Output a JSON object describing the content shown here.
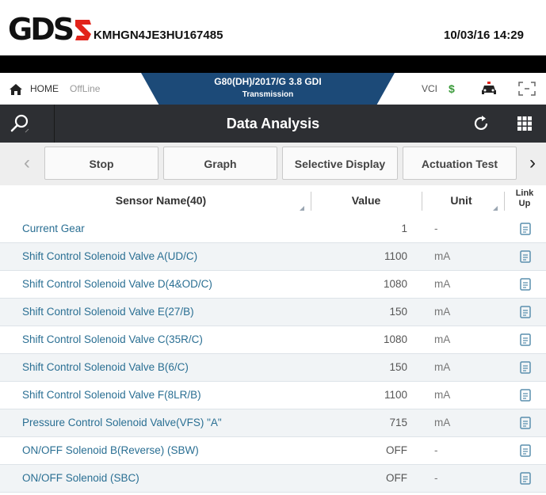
{
  "header": {
    "logo_text": "GDS",
    "vin": "KMHGN4JE3HU167485",
    "datetime": "10/03/16 14:29"
  },
  "nav": {
    "home_label": "HOME",
    "status": "OffLine",
    "vehicle": "G80(DH)/2017/G 3.8 GDI",
    "system": "Transmission",
    "vci_label": "VCI"
  },
  "page": {
    "title": "Data Analysis"
  },
  "toolbar": {
    "stop": "Stop",
    "graph": "Graph",
    "selective_display": "Selective Display",
    "actuation_test": "Actuation Test"
  },
  "table": {
    "columns": {
      "sensor": "Sensor Name(40)",
      "value": "Value",
      "unit": "Unit",
      "link_up_1": "Link",
      "link_up_2": "Up"
    },
    "rows": [
      {
        "name": "Current Gear",
        "value": "1",
        "unit": "-"
      },
      {
        "name": "Shift Control Solenoid Valve A(UD/C)",
        "value": "1100",
        "unit": "mA"
      },
      {
        "name": "Shift Control Solenoid Valve D(4&OD/C)",
        "value": "1080",
        "unit": "mA"
      },
      {
        "name": "Shift Control Solenoid Valve E(27/B)",
        "value": "150",
        "unit": "mA"
      },
      {
        "name": "Shift Control Solenoid Valve C(35R/C)",
        "value": "1080",
        "unit": "mA"
      },
      {
        "name": "Shift Control Solenoid Valve B(6/C)",
        "value": "150",
        "unit": "mA"
      },
      {
        "name": "Shift Control Solenoid Valve F(8LR/B)",
        "value": "1100",
        "unit": "mA"
      },
      {
        "name": "Pressure Control Solenoid Valve(VFS) \"A\"",
        "value": "715",
        "unit": "mA"
      },
      {
        "name": "ON/OFF Solenoid B(Reverse) (SBW)",
        "value": "OFF",
        "unit": "-"
      },
      {
        "name": "ON/OFF Solenoid (SBC)",
        "value": "OFF",
        "unit": "-"
      }
    ]
  },
  "colors": {
    "accent": "#1c4a78",
    "header_bar": "#2d2f33",
    "sensor_text": "#2a6f93",
    "logo_red": "#e2231a"
  }
}
